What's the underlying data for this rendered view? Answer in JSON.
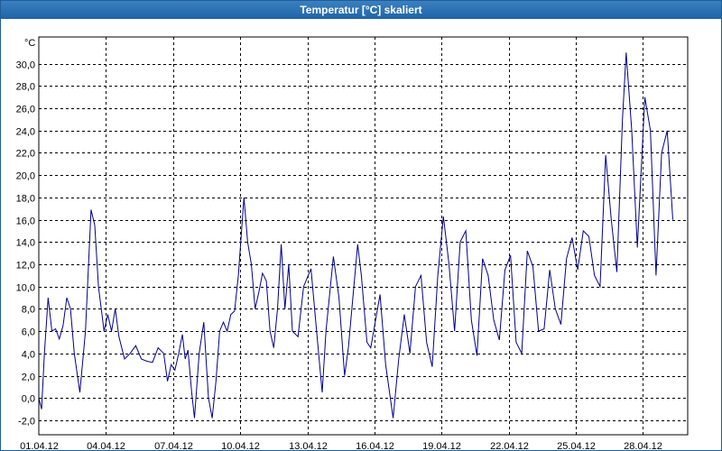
{
  "window": {
    "title": "Temperatur [°C] skaliert"
  },
  "chart_data": {
    "type": "line",
    "title": "Temperatur [°C] skaliert",
    "ylabel": "°C",
    "ylim": [
      -3.3,
      32.4
    ],
    "xlim": [
      "2012-04-01",
      "2012-04-30"
    ],
    "grid": true,
    "yticks": [
      "30,0",
      "28,0",
      "26,0",
      "24,0",
      "22,0",
      "20,0",
      "18,0",
      "16,0",
      "14,0",
      "12,0",
      "10,0",
      "8,0",
      "6,0",
      "4,0",
      "2,0",
      "0,0",
      "-2,0"
    ],
    "ytick_values": [
      30,
      28,
      26,
      24,
      22,
      20,
      18,
      16,
      14,
      12,
      10,
      8,
      6,
      4,
      2,
      0,
      -2
    ],
    "xticks": [
      "01.04.12",
      "04.04.12",
      "07.04.12",
      "10.04.12",
      "13.04.12",
      "16.04.12",
      "19.04.12",
      "22.04.12",
      "25.04.12",
      "28.04.12"
    ],
    "xtick_dates": [
      "2012-04-01",
      "2012-04-04",
      "2012-04-07",
      "2012-04-10",
      "2012-04-13",
      "2012-04-16",
      "2012-04-19",
      "2012-04-22",
      "2012-04-25",
      "2012-04-28"
    ],
    "series": [
      {
        "color": "#00008b",
        "points": [
          [
            "2012-04-01 00:00",
            0.0
          ],
          [
            "2012-04-01 03:00",
            -1.0
          ],
          [
            "2012-04-01 06:00",
            4.0
          ],
          [
            "2012-04-01 10:00",
            9.0
          ],
          [
            "2012-04-01 14:00",
            6.0
          ],
          [
            "2012-04-01 18:00",
            6.2
          ],
          [
            "2012-04-01 22:00",
            5.3
          ],
          [
            "2012-04-02 02:00",
            6.5
          ],
          [
            "2012-04-02 06:00",
            9.0
          ],
          [
            "2012-04-02 10:00",
            8.0
          ],
          [
            "2012-04-02 14:00",
            4.0
          ],
          [
            "2012-04-02 20:00",
            0.5
          ],
          [
            "2012-04-03 02:00",
            6.0
          ],
          [
            "2012-04-03 08:00",
            16.9
          ],
          [
            "2012-04-03 12:00",
            15.5
          ],
          [
            "2012-04-03 16:00",
            10.0
          ],
          [
            "2012-04-03 22:00",
            6.0
          ],
          [
            "2012-04-04 02:00",
            7.5
          ],
          [
            "2012-04-04 06:00",
            6.0
          ],
          [
            "2012-04-04 10:00",
            8.0
          ],
          [
            "2012-04-04 14:00",
            5.5
          ],
          [
            "2012-04-04 20:00",
            3.5
          ],
          [
            "2012-04-05 02:00",
            4.0
          ],
          [
            "2012-04-05 08:00",
            4.7
          ],
          [
            "2012-04-05 14:00",
            3.5
          ],
          [
            "2012-04-05 20:00",
            3.3
          ],
          [
            "2012-04-06 02:00",
            3.2
          ],
          [
            "2012-04-06 08:00",
            4.5
          ],
          [
            "2012-04-06 14:00",
            4.0
          ],
          [
            "2012-04-06 18:00",
            1.5
          ],
          [
            "2012-04-06 22:00",
            3.0
          ],
          [
            "2012-04-07 02:00",
            2.5
          ],
          [
            "2012-04-07 06:00",
            4.0
          ],
          [
            "2012-04-07 10:00",
            5.7
          ],
          [
            "2012-04-07 13:00",
            3.5
          ],
          [
            "2012-04-07 16:00",
            4.3
          ],
          [
            "2012-04-07 20:00",
            0.5
          ],
          [
            "2012-04-07 23:00",
            -1.8
          ],
          [
            "2012-04-08 04:00",
            4.0
          ],
          [
            "2012-04-08 09:00",
            6.8
          ],
          [
            "2012-04-08 14:00",
            0.0
          ],
          [
            "2012-04-08 18:00",
            -1.8
          ],
          [
            "2012-04-08 22:00",
            1.5
          ],
          [
            "2012-04-09 02:00",
            6.0
          ],
          [
            "2012-04-09 06:00",
            6.8
          ],
          [
            "2012-04-09 10:00",
            6.0
          ],
          [
            "2012-04-09 14:00",
            7.5
          ],
          [
            "2012-04-09 18:00",
            7.8
          ],
          [
            "2012-04-09 22:00",
            11.0
          ],
          [
            "2012-04-10 04:00",
            18.0
          ],
          [
            "2012-04-10 08:00",
            14.0
          ],
          [
            "2012-04-10 12:00",
            12.0
          ],
          [
            "2012-04-10 16:00",
            8.0
          ],
          [
            "2012-04-10 20:00",
            9.5
          ],
          [
            "2012-04-11 00:00",
            11.2
          ],
          [
            "2012-04-11 04:00",
            10.5
          ],
          [
            "2012-04-11 08:00",
            6.0
          ],
          [
            "2012-04-11 12:00",
            4.5
          ],
          [
            "2012-04-11 16:00",
            8.0
          ],
          [
            "2012-04-11 20:00",
            13.8
          ],
          [
            "2012-04-12 00:00",
            8.0
          ],
          [
            "2012-04-12 04:00",
            12.0
          ],
          [
            "2012-04-12 08:00",
            6.0
          ],
          [
            "2012-04-12 14:00",
            5.5
          ],
          [
            "2012-04-12 20:00",
            10.0
          ],
          [
            "2012-04-13 04:00",
            11.6
          ],
          [
            "2012-04-13 10:00",
            6.0
          ],
          [
            "2012-04-13 16:00",
            0.5
          ],
          [
            "2012-04-13 20:00",
            6.0
          ],
          [
            "2012-04-14 04:00",
            12.7
          ],
          [
            "2012-04-14 10:00",
            9.0
          ],
          [
            "2012-04-14 16:00",
            2.0
          ],
          [
            "2012-04-14 20:00",
            4.5
          ],
          [
            "2012-04-15 06:00",
            13.8
          ],
          [
            "2012-04-15 10:00",
            11.0
          ],
          [
            "2012-04-15 16:00",
            5.0
          ],
          [
            "2012-04-15 20:00",
            4.5
          ],
          [
            "2012-04-16 06:00",
            9.3
          ],
          [
            "2012-04-16 12:00",
            3.0
          ],
          [
            "2012-04-16 20:00",
            -1.8
          ],
          [
            "2012-04-17 02:00",
            3.5
          ],
          [
            "2012-04-17 08:00",
            7.5
          ],
          [
            "2012-04-17 14:00",
            4.0
          ],
          [
            "2012-04-17 20:00",
            10.0
          ],
          [
            "2012-04-18 02:00",
            11.0
          ],
          [
            "2012-04-18 08:00",
            5.0
          ],
          [
            "2012-04-18 14:00",
            2.8
          ],
          [
            "2012-04-18 20:00",
            11.0
          ],
          [
            "2012-04-19 02:00",
            16.3
          ],
          [
            "2012-04-19 08:00",
            12.0
          ],
          [
            "2012-04-19 14:00",
            6.0
          ],
          [
            "2012-04-19 20:00",
            14.0
          ],
          [
            "2012-04-20 02:00",
            15.0
          ],
          [
            "2012-04-20 08:00",
            7.0
          ],
          [
            "2012-04-20 14:00",
            3.8
          ],
          [
            "2012-04-20 20:00",
            12.5
          ],
          [
            "2012-04-21 02:00",
            11.0
          ],
          [
            "2012-04-21 08:00",
            7.0
          ],
          [
            "2012-04-21 14:00",
            5.2
          ],
          [
            "2012-04-21 20:00",
            11.5
          ],
          [
            "2012-04-22 02:00",
            12.8
          ],
          [
            "2012-04-22 08:00",
            5.0
          ],
          [
            "2012-04-22 14:00",
            4.0
          ],
          [
            "2012-04-22 20:00",
            13.2
          ],
          [
            "2012-04-23 02:00",
            11.8
          ],
          [
            "2012-04-23 08:00",
            6.0
          ],
          [
            "2012-04-23 14:00",
            6.2
          ],
          [
            "2012-04-23 20:00",
            11.5
          ],
          [
            "2012-04-24 02:00",
            8.0
          ],
          [
            "2012-04-24 08:00",
            6.6
          ],
          [
            "2012-04-24 14:00",
            12.5
          ],
          [
            "2012-04-24 20:00",
            14.4
          ],
          [
            "2012-04-25 02:00",
            11.5
          ],
          [
            "2012-04-25 08:00",
            15.0
          ],
          [
            "2012-04-25 14:00",
            14.5
          ],
          [
            "2012-04-25 20:00",
            11.0
          ],
          [
            "2012-04-26 02:00",
            10.0
          ],
          [
            "2012-04-26 08:00",
            21.8
          ],
          [
            "2012-04-26 14:00",
            16.0
          ],
          [
            "2012-04-26 20:00",
            11.3
          ],
          [
            "2012-04-27 02:00",
            25.0
          ],
          [
            "2012-04-27 06:00",
            31.0
          ],
          [
            "2012-04-27 12:00",
            24.0
          ],
          [
            "2012-04-27 18:00",
            13.5
          ],
          [
            "2012-04-28 02:00",
            27.0
          ],
          [
            "2012-04-28 08:00",
            24.0
          ],
          [
            "2012-04-28 14:00",
            11.0
          ],
          [
            "2012-04-28 20:00",
            22.0
          ],
          [
            "2012-04-29 02:00",
            24.0
          ],
          [
            "2012-04-29 08:00",
            16.0
          ]
        ]
      }
    ]
  }
}
